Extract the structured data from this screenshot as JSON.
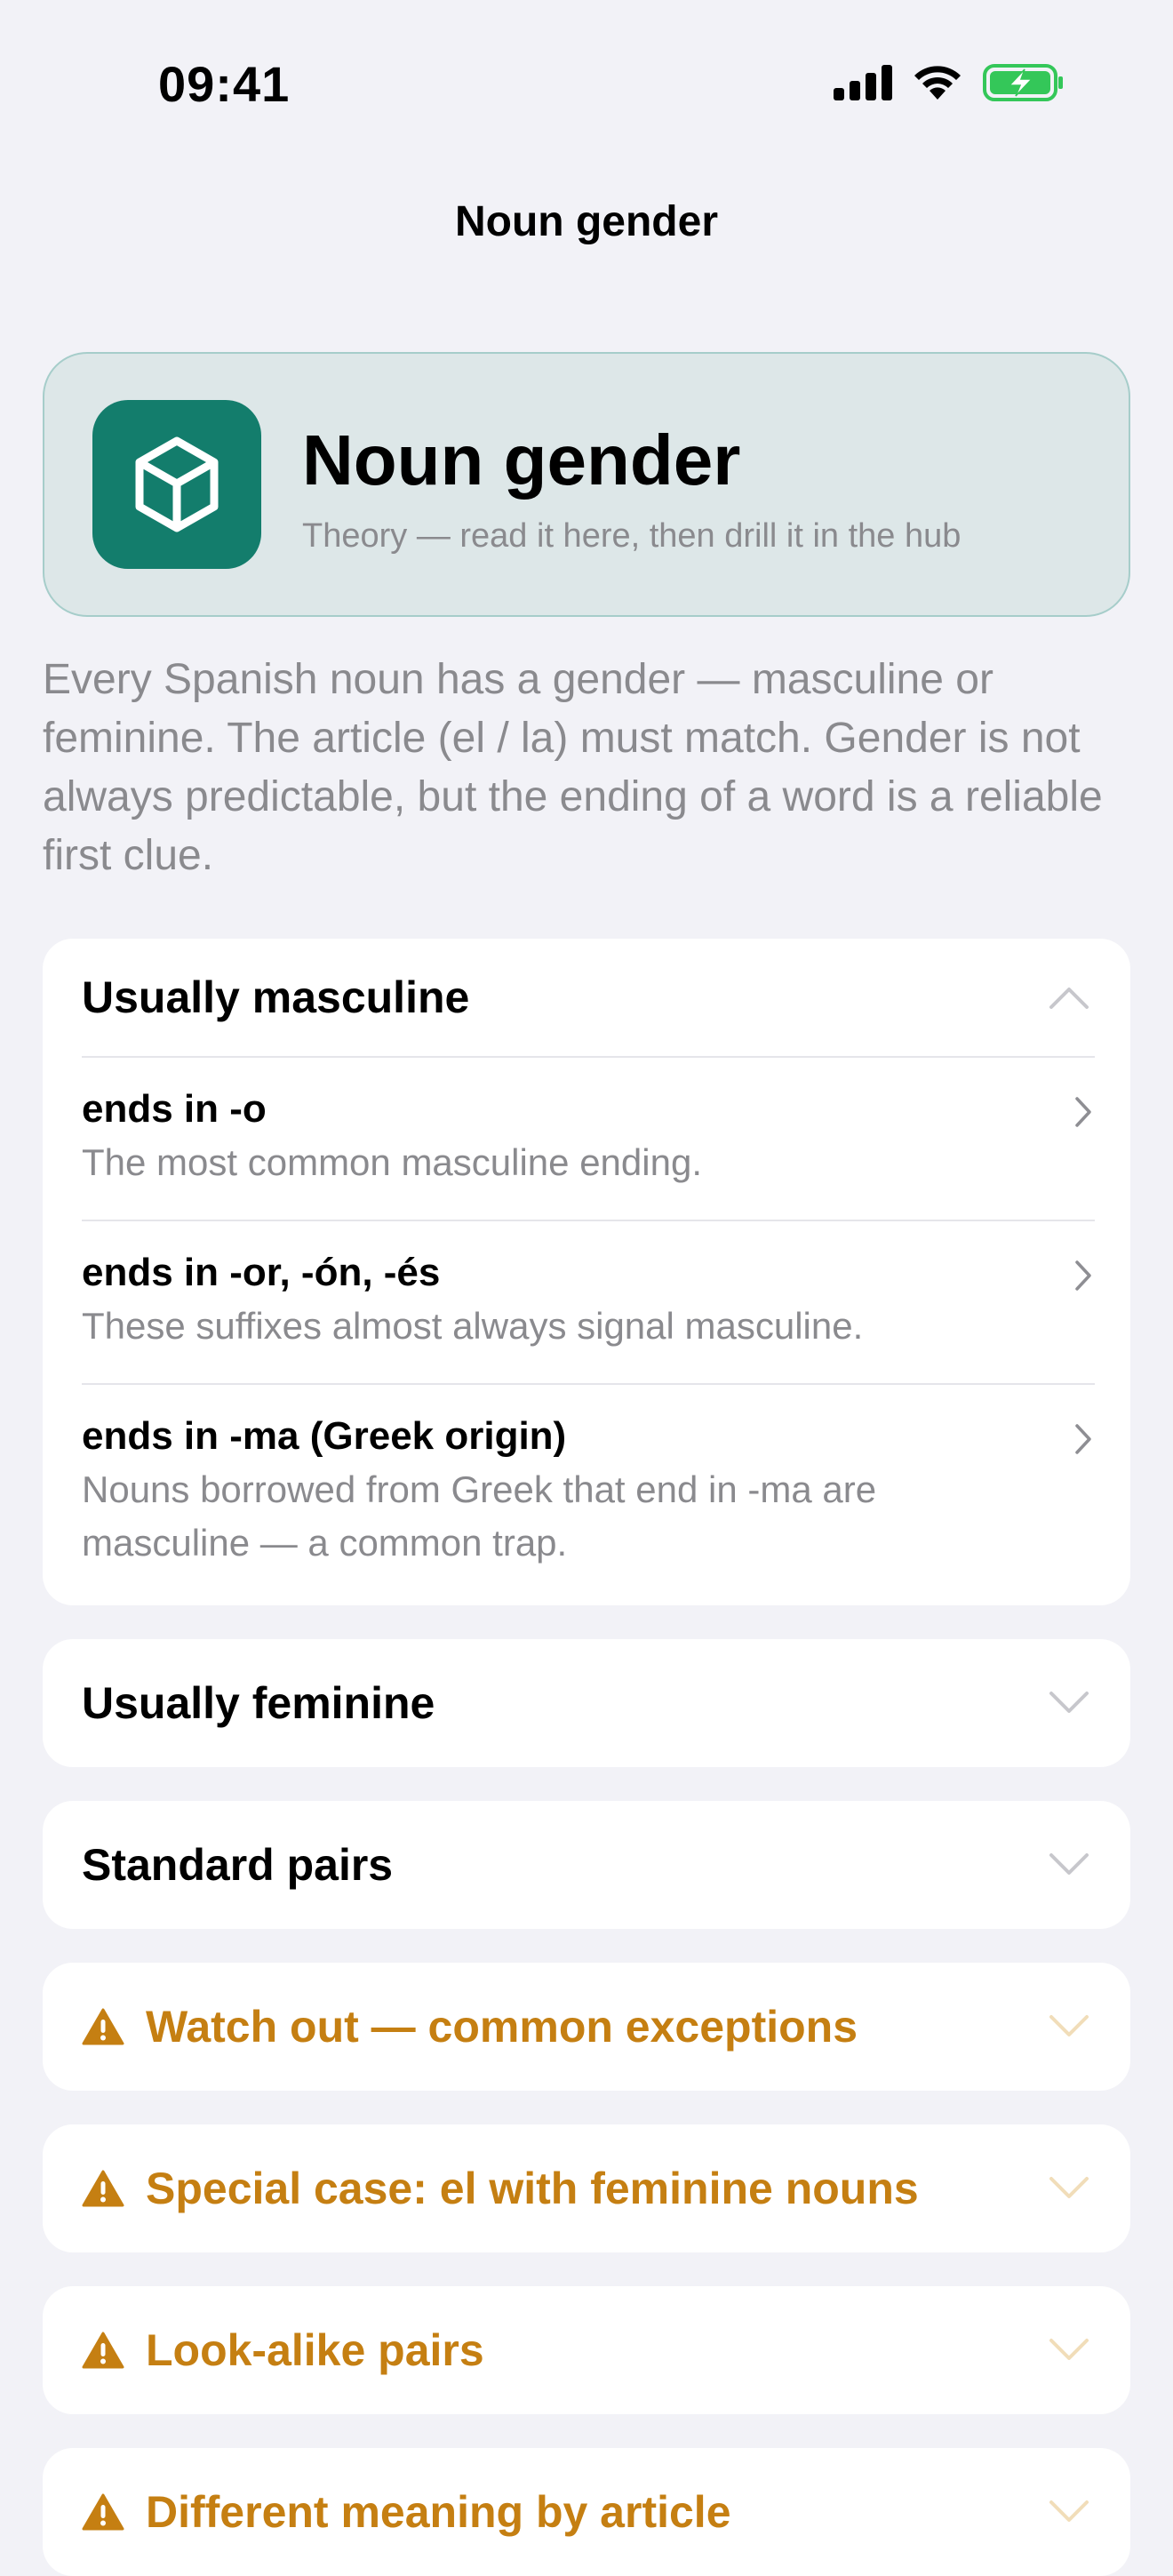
{
  "status": {
    "time": "09:41"
  },
  "nav": {
    "title": "Noun gender"
  },
  "hero": {
    "title": "Noun gender",
    "subtitle": "Theory — read it here, then drill it in the hub",
    "icon": "cube-icon",
    "accent": "#137d6c"
  },
  "intro": "Every Spanish noun has a gender — masculine or feminine. The article (el / la) must match. Gender is not always predictable, but the ending of a word is a reliable first clue.",
  "sections": [
    {
      "title": "Usually masculine",
      "expanded": true,
      "rows": [
        {
          "title": "ends in -o",
          "desc": "The most common masculine ending."
        },
        {
          "title": "ends in -or, -ón, -és",
          "desc": "These suffixes almost always signal masculine."
        },
        {
          "title": "ends in -ma (Greek origin)",
          "desc": "Nouns borrowed from Greek that end in -ma are masculine — a common trap."
        }
      ]
    },
    {
      "title": "Usually feminine",
      "expanded": false
    },
    {
      "title": "Standard pairs",
      "expanded": false
    },
    {
      "title": "Watch out — common exceptions",
      "warning": true,
      "expanded": false
    },
    {
      "title": "Special case: el with feminine nouns",
      "warning": true,
      "expanded": false
    },
    {
      "title": "Look-alike pairs",
      "warning": true,
      "expanded": false
    },
    {
      "title": "Different meaning by article",
      "warning": true,
      "expanded": false
    }
  ],
  "colors": {
    "warning": "#c57f12",
    "background": "#f2f2f7"
  }
}
